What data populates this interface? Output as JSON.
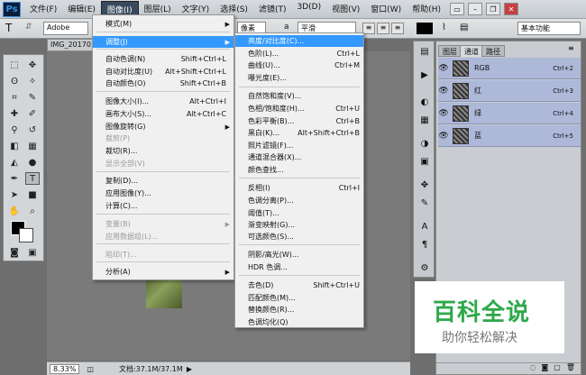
{
  "app": {
    "logo": "Ps"
  },
  "menubar": [
    "文件(F)",
    "编辑(E)",
    "图像(I)",
    "图层(L)",
    "文字(Y)",
    "选择(S)",
    "滤镜(T)",
    "3D(D)",
    "视图(V)",
    "窗口(W)",
    "帮助(H)"
  ],
  "optbar": {
    "font": "Adobe",
    "unit": "像素",
    "aa": "平滑",
    "workspace": "基本功能",
    "aa_prefix": "a"
  },
  "document": {
    "tab": "IMG_20170"
  },
  "status": {
    "zoom": "8.33%",
    "doc": "文档:37.1M/37.1M"
  },
  "image_menu": {
    "items": [
      {
        "label": "模式(M)",
        "sc": "",
        "sub": true,
        "dis": false
      },
      {
        "label": "调整(J)",
        "sc": "",
        "sub": true,
        "dis": false,
        "hl": true
      },
      {
        "label": "自动色调(N)",
        "sc": "Shift+Ctrl+L"
      },
      {
        "label": "自动对比度(U)",
        "sc": "Alt+Shift+Ctrl+L"
      },
      {
        "label": "自动颜色(O)",
        "sc": "Shift+Ctrl+B"
      },
      {
        "label": "图像大小(I)...",
        "sc": "Alt+Ctrl+I"
      },
      {
        "label": "画布大小(S)...",
        "sc": "Alt+Ctrl+C"
      },
      {
        "label": "图像旋转(G)",
        "sc": "",
        "sub": true
      },
      {
        "label": "裁剪(P)",
        "sc": "",
        "dis": true
      },
      {
        "label": "裁切(R)...",
        "sc": ""
      },
      {
        "label": "显示全部(V)",
        "sc": "",
        "dis": true
      },
      {
        "label": "复制(D)...",
        "sc": ""
      },
      {
        "label": "应用图像(Y)...",
        "sc": ""
      },
      {
        "label": "计算(C)...",
        "sc": ""
      },
      {
        "label": "变量(B)",
        "sc": "",
        "sub": true,
        "dis": true
      },
      {
        "label": "应用数据组(L)...",
        "sc": "",
        "dis": true
      },
      {
        "label": "陷印(T)...",
        "sc": "",
        "dis": true
      },
      {
        "label": "分析(A)",
        "sc": "",
        "sub": true
      }
    ]
  },
  "adjust_menu": {
    "items": [
      {
        "label": "亮度/对比度(C)...",
        "sc": "",
        "hl": true
      },
      {
        "label": "色阶(L)...",
        "sc": "Ctrl+L"
      },
      {
        "label": "曲线(U)...",
        "sc": "Ctrl+M"
      },
      {
        "label": "曝光度(E)...",
        "sc": ""
      },
      {
        "label": "自然饱和度(V)...",
        "sc": ""
      },
      {
        "label": "色相/饱和度(H)...",
        "sc": "Ctrl+U"
      },
      {
        "label": "色彩平衡(B)...",
        "sc": "Ctrl+B"
      },
      {
        "label": "黑白(K)...",
        "sc": "Alt+Shift+Ctrl+B"
      },
      {
        "label": "照片滤镜(F)...",
        "sc": ""
      },
      {
        "label": "通道混合器(X)...",
        "sc": ""
      },
      {
        "label": "颜色查找...",
        "sc": ""
      },
      {
        "label": "反相(I)",
        "sc": "Ctrl+I"
      },
      {
        "label": "色调分离(P)...",
        "sc": ""
      },
      {
        "label": "阈值(T)...",
        "sc": ""
      },
      {
        "label": "渐变映射(G)...",
        "sc": ""
      },
      {
        "label": "可选颜色(S)...",
        "sc": ""
      },
      {
        "label": "阴影/高光(W)...",
        "sc": ""
      },
      {
        "label": "HDR 色调...",
        "sc": ""
      },
      {
        "label": "去色(D)",
        "sc": "Shift+Ctrl+U"
      },
      {
        "label": "匹配颜色(M)...",
        "sc": ""
      },
      {
        "label": "替换颜色(R)...",
        "sc": ""
      },
      {
        "label": "色调均化(Q)",
        "sc": ""
      }
    ]
  },
  "panel": {
    "tabs": [
      "图层",
      "通道",
      "路径"
    ],
    "channels": [
      {
        "name": "RGB",
        "key": "Ctrl+2"
      },
      {
        "name": "红",
        "key": "Ctrl+3"
      },
      {
        "name": "绿",
        "key": "Ctrl+4"
      },
      {
        "name": "蓝",
        "key": "Ctrl+5"
      }
    ]
  },
  "watermark": {
    "title": "百科全说",
    "sub": "助你轻松解决",
    "title_color": "#2ea84a"
  }
}
